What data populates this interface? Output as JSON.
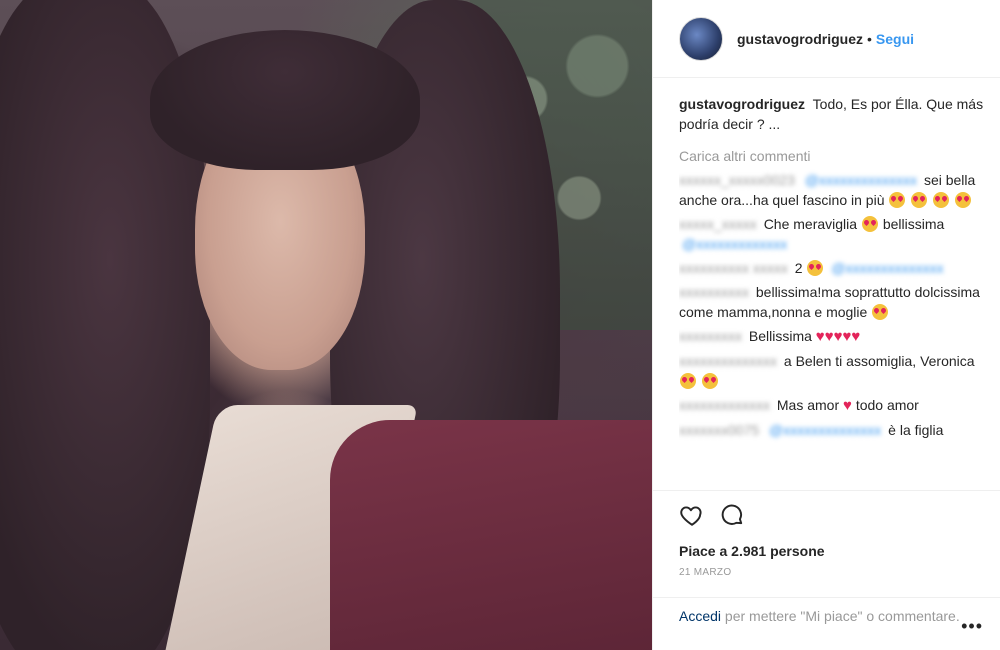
{
  "post": {
    "username": "gustavogrodriguez",
    "separator": "•",
    "follow_label": "Segui",
    "caption_text": "Todo, Es por Élla. Que más podría decir ? ..."
  },
  "comments": {
    "load_more": "Carica altri commenti",
    "items": [
      {
        "user": "xxxxxx_xxxxx0023",
        "mention": "@xxxxxxxxxxxxxx",
        "text": "sei bella anche ora...ha quel fascino in più"
      },
      {
        "user": "xxxxx_xxxxx",
        "text": "Che meraviglia",
        "text2": "bellissima",
        "mention": "@xxxxxxxxxxxxx"
      },
      {
        "user": "xxxxxxxxxx xxxxx",
        "text": "2",
        "mention": "@xxxxxxxxxxxxxx"
      },
      {
        "user": "xxxxxxxxxx",
        "text": "bellissima!ma soprattutto dolcissima come mamma,nonna e moglie"
      },
      {
        "user": "xxxxxxxxx",
        "text": "Bellissima"
      },
      {
        "user": "xxxxxxxxxxxxxx",
        "text": "a Belen ti assomiglia, Veronica"
      },
      {
        "user": "xxxxxxxxxxxxx",
        "text": "Mas amor",
        "text2": "todo amor"
      },
      {
        "user": "xxxxxxx0075",
        "mention": "@xxxxxxxxxxxxxx",
        "text": "è la figlia"
      }
    ]
  },
  "actions": {
    "likes_text": "Piace a 2.981 persone",
    "date": "21 MARZO",
    "login_link": "Accedi",
    "login_rest": "per mettere \"Mi piace\" o commentare.",
    "more": "•••"
  }
}
